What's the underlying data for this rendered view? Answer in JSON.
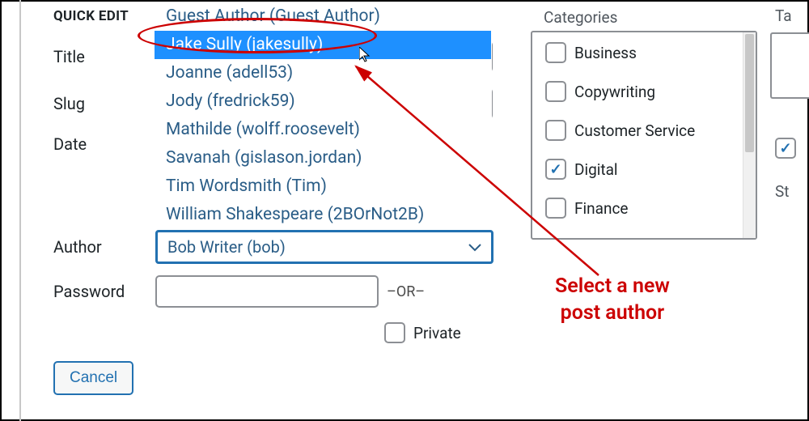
{
  "panel": {
    "title": "QUICK EDIT"
  },
  "fields": {
    "title_label": "Title",
    "slug_label": "Slug",
    "date_label": "Date",
    "author_label": "Author",
    "password_label": "Password",
    "or_text": "–OR–",
    "private_label": "Private"
  },
  "author": {
    "selected": "Bob Writer (bob)",
    "options": [
      "Guest Author (Guest Author)",
      "Jake Sully (jakesully)",
      "Joanne (adell53)",
      "Jody (fredrick59)",
      "Mathilde (wolff.roosevelt)",
      "Savanah (gislason.jordan)",
      "Tim Wordsmith (Tim)",
      "William Shakespeare (2BOrNot2B)"
    ],
    "highlighted_index": 1
  },
  "categories": {
    "label": "Categories",
    "items": [
      {
        "label": "Business",
        "checked": false
      },
      {
        "label": "Copywriting",
        "checked": false
      },
      {
        "label": "Customer Service",
        "checked": false
      },
      {
        "label": "Digital",
        "checked": true
      },
      {
        "label": "Finance",
        "checked": false
      }
    ]
  },
  "right": {
    "tag_label": "Ta",
    "sta_label": "St"
  },
  "buttons": {
    "cancel": "Cancel"
  },
  "annotation": {
    "line1": "Select a new",
    "line2": "post author"
  }
}
